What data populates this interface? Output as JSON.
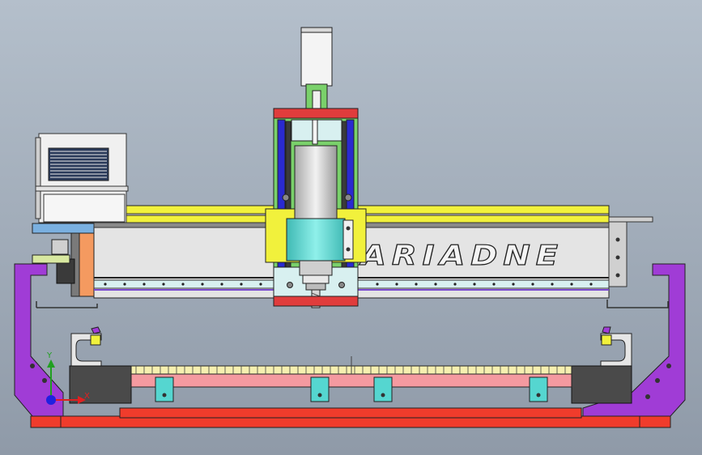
{
  "viewport": {
    "background_top": "#b4bfcb",
    "background_bottom": "#8f9aa8"
  },
  "machine": {
    "brand_text": "ARIADNE",
    "colors": {
      "spindle_motor": "#f4f4f4",
      "coupling": "#7ad16b",
      "z_plate": "#e03c3c",
      "z_column": "#7ad16b",
      "z_rail": "#2a2ad0",
      "gantry_body": "#e4e4e4",
      "gantry_top_rail": "#f1f13c",
      "carriage": "#f1f13c",
      "spindle_clamp": "#55d6d0",
      "spindle_body": "#d8d8d8",
      "cable_chain": "#d8f0f0",
      "side_frame": "#a03cd6",
      "base_plate": "#f03c2c",
      "table_bed": "#f49aa0",
      "table_teeth": "#f6f0b0",
      "support_blocks": "#4a4a4a",
      "table_legs": "#55d6d0",
      "motor_box": "#f0f0f0",
      "motor_fins": "#2a3a5a",
      "side_mount": "#f49a60",
      "blue_bracket": "#7ab0e0"
    }
  },
  "axes": {
    "x_label": "X",
    "y_label": "Y",
    "x_color": "#e02020",
    "y_color": "#20a020",
    "origin_color": "#2020e0"
  }
}
